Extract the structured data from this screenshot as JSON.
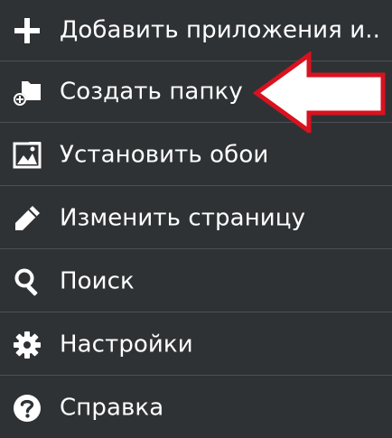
{
  "menu": {
    "items": [
      {
        "label": "Добавить приложения и..",
        "icon": "plus-icon"
      },
      {
        "label": "Создать папку",
        "icon": "new-folder-icon"
      },
      {
        "label": "Установить обои",
        "icon": "wallpaper-icon"
      },
      {
        "label": "Изменить страницу",
        "icon": "pencil-icon"
      },
      {
        "label": "Поиск",
        "icon": "search-icon"
      },
      {
        "label": "Настройки",
        "icon": "gear-icon"
      },
      {
        "label": "Справка",
        "icon": "help-icon"
      }
    ]
  },
  "colors": {
    "background": "#2f3235",
    "divider": "#4b4f53",
    "text": "#ffffff",
    "arrow_outline": "#d9121f",
    "arrow_fill": "#ffffff"
  }
}
